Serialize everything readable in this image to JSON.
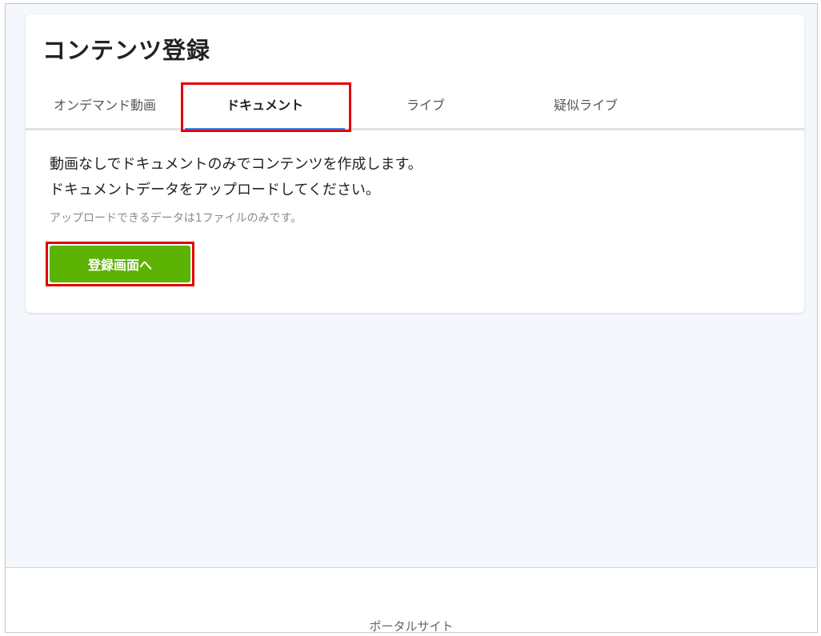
{
  "page": {
    "title": "コンテンツ登録"
  },
  "tabs": [
    {
      "label": "オンデマンド動画",
      "active": false
    },
    {
      "label": "ドキュメント",
      "active": true
    },
    {
      "label": "ライブ",
      "active": false
    },
    {
      "label": "疑似ライブ",
      "active": false
    }
  ],
  "document_tab": {
    "description_line1": "動画なしでドキュメントのみでコンテンツを作成します。",
    "description_line2": "ドキュメントデータをアップロードしてください。",
    "note": "アップロードできるデータは1ファイルのみです。",
    "register_button": "登録画面へ"
  },
  "footer": {
    "link": "ポータルサイト"
  },
  "colors": {
    "accent_tab_underline": "#3f7fe4",
    "primary_button": "#5cb200",
    "highlight_box": "#e00000",
    "background": "#f4f7fb"
  }
}
